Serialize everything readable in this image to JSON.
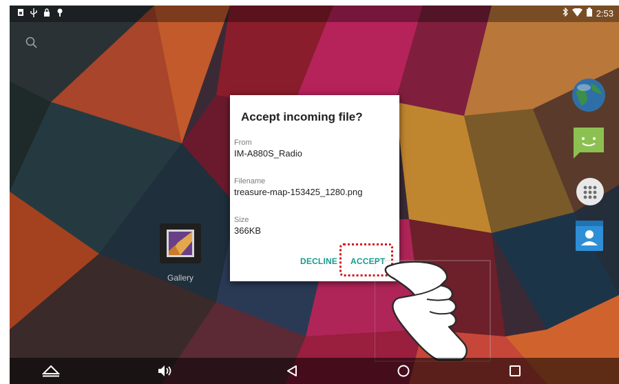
{
  "status_bar": {
    "time": "2:53",
    "left_icons": [
      "sim-icon",
      "usb-icon",
      "lock-icon",
      "download-icon"
    ],
    "right_icons": [
      "bluetooth-icon",
      "wifi-icon",
      "battery-icon"
    ]
  },
  "home": {
    "gallery_label": "Gallery",
    "dock_icons": [
      "globe-icon",
      "messaging-icon",
      "app-drawer-icon",
      "contacts-icon"
    ]
  },
  "dialog": {
    "title": "Accept incoming file?",
    "from_label": "From",
    "from_value": "IM-A880S_Radio",
    "filename_label": "Filename",
    "filename_value": "treasure-map-153425_1280.png",
    "size_label": "Size",
    "size_value": "366KB",
    "decline_label": "DECLINE",
    "accept_label": "ACCEPT"
  },
  "colors": {
    "accent": "#169b8c",
    "highlight": "#d4141c"
  },
  "nav_bar": [
    "home-up-icon",
    "volume-icon",
    "back-icon",
    "home-icon",
    "recents-icon"
  ]
}
